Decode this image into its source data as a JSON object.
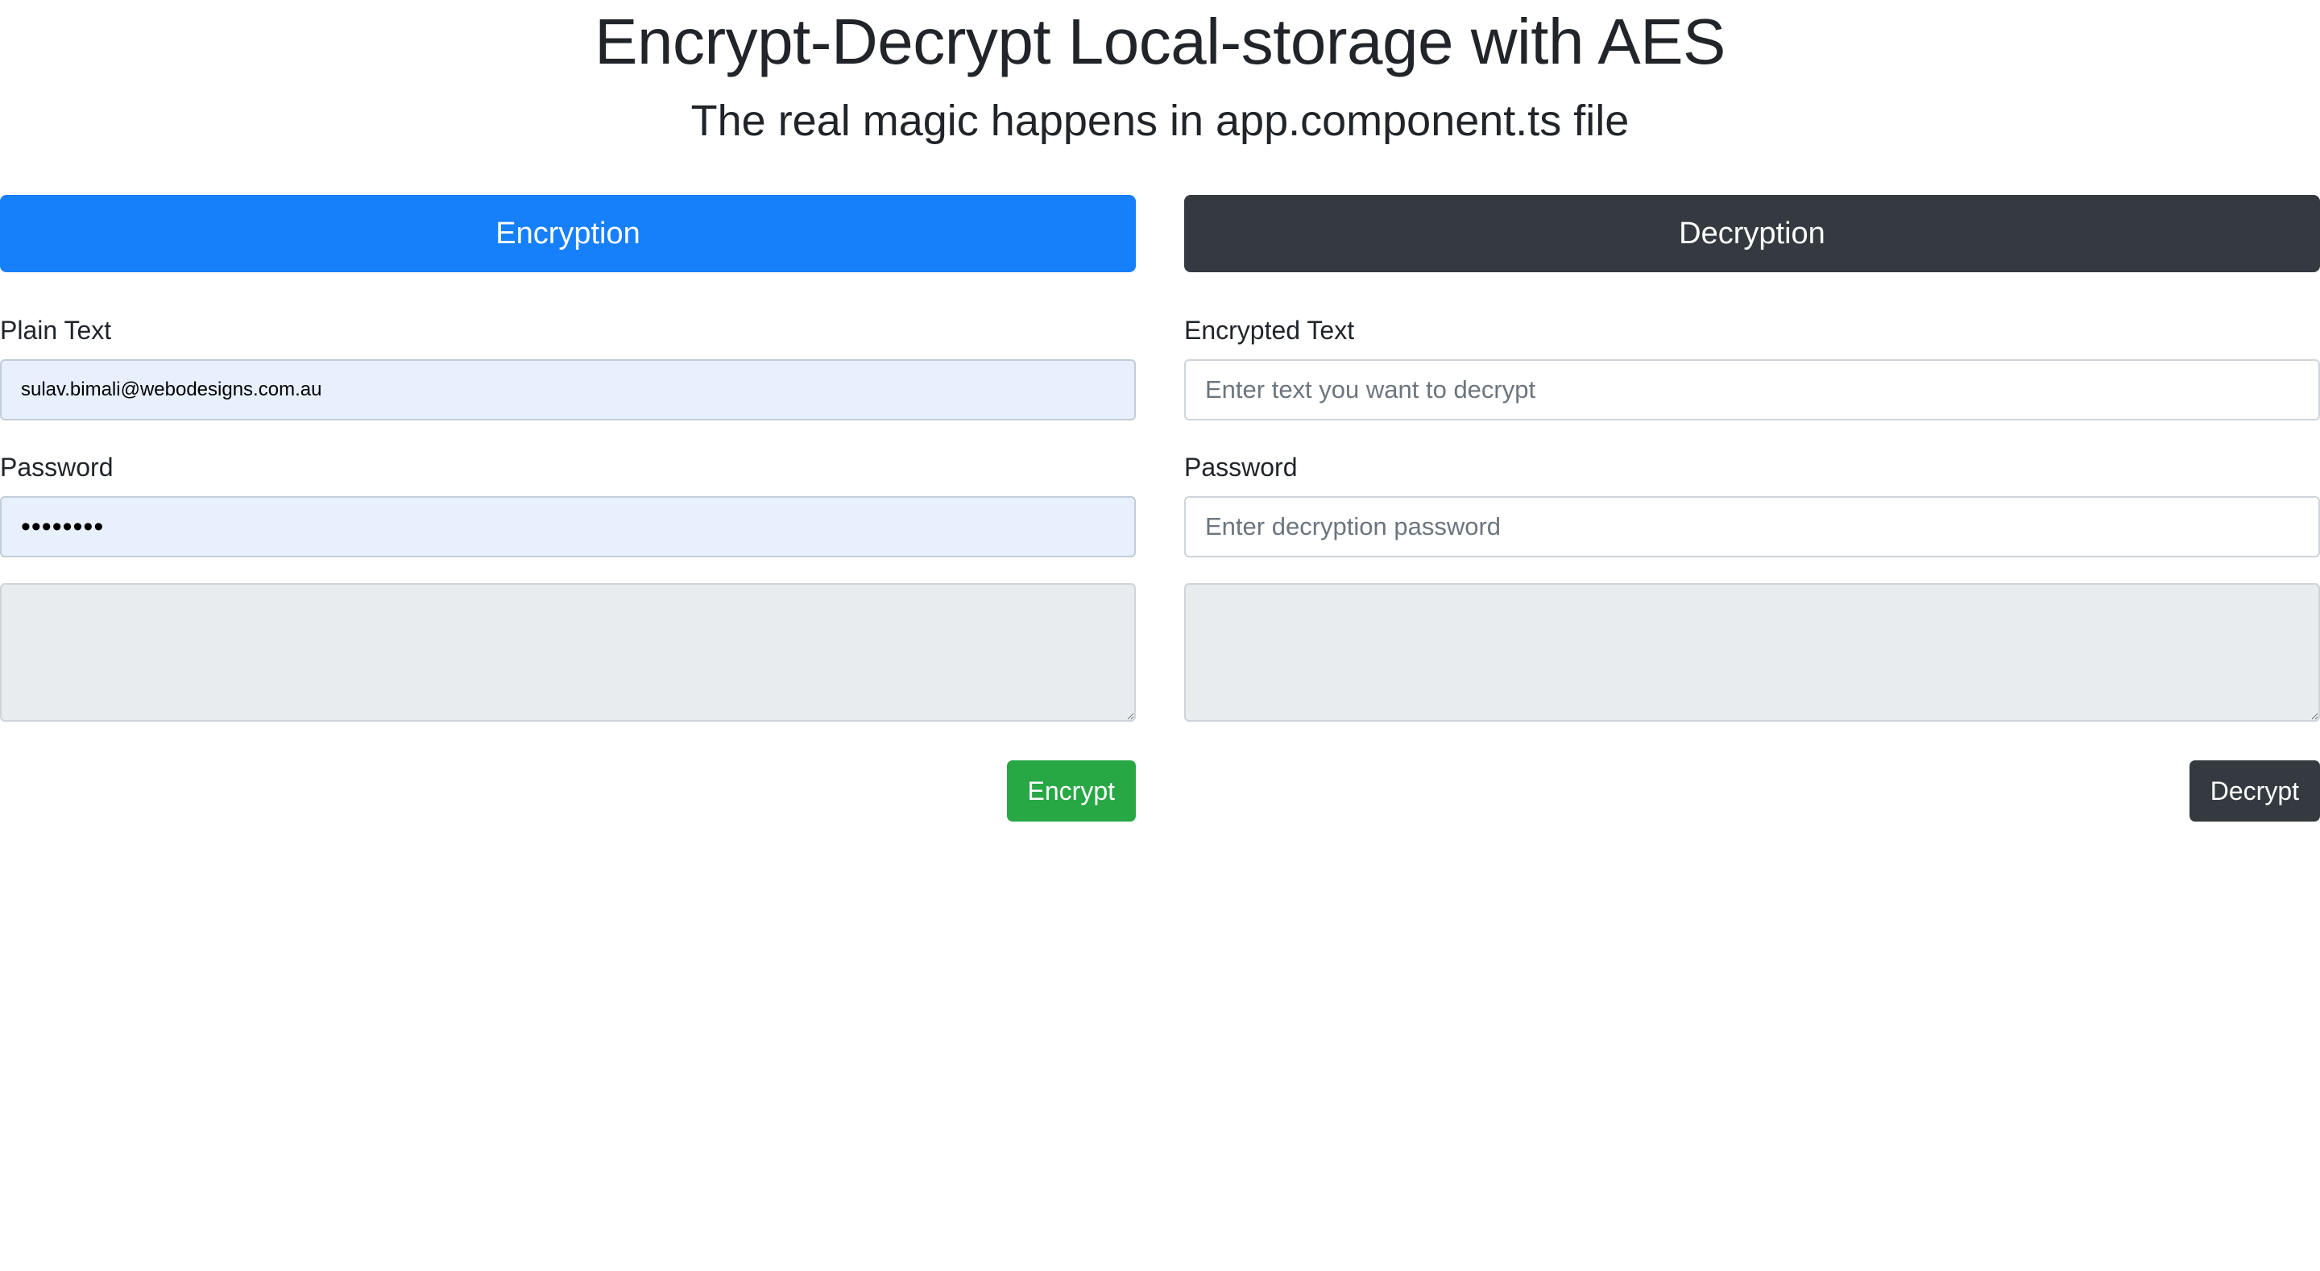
{
  "header": {
    "title": "Encrypt-Decrypt Local-storage with AES",
    "subtitle": "The real magic happens in app.component.ts file"
  },
  "encryption": {
    "banner_label": "Encryption",
    "plain_text_label": "Plain Text",
    "plain_text_value": "sulav.bimali@webodesigns.com.au",
    "password_label": "Password",
    "password_value": "••••••••",
    "output_value": "",
    "button_label": "Encrypt"
  },
  "decryption": {
    "banner_label": "Decryption",
    "encrypted_text_label": "Encrypted Text",
    "encrypted_text_placeholder": "Enter text you want to decrypt",
    "password_label": "Password",
    "password_placeholder": "Enter decryption password",
    "output_value": "",
    "button_label": "Decrypt"
  },
  "colors": {
    "encryption_banner": "#167ffa",
    "decryption_banner": "#343a40",
    "encrypt_button": "#28a745",
    "decrypt_button": "#343a40",
    "autofill_background": "#e8f0fe",
    "readonly_background": "#e9ecef"
  }
}
